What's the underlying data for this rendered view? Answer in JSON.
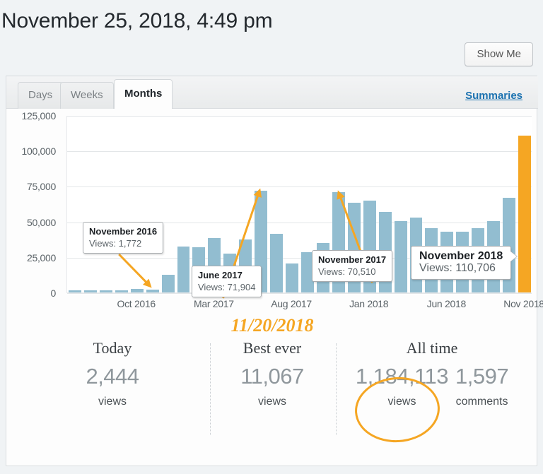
{
  "header": {
    "title": "November 25, 2018, 4:49 pm",
    "show_me_label": "Show Me"
  },
  "tabs": [
    {
      "label": "Days",
      "active": false
    },
    {
      "label": "Weeks",
      "active": false
    },
    {
      "label": "Months",
      "active": true
    }
  ],
  "summaries_link": "Summaries",
  "chart_data": {
    "type": "bar",
    "title": "",
    "xlabel": "",
    "ylabel": "",
    "ylim": [
      0,
      125000
    ],
    "grid": true,
    "legend": "none",
    "ytick_labels": [
      "125,000",
      "100,000",
      "75,000",
      "50,000",
      "25,000",
      "0"
    ],
    "ytick_values": [
      125000,
      100000,
      75000,
      50000,
      25000,
      0
    ],
    "xtick_labels": [
      "Oct 2016",
      "Mar 2017",
      "Aug 2017",
      "Jan 2018",
      "Jun 2018",
      "Nov 2018"
    ],
    "xtick_indices": [
      4,
      9,
      14,
      19,
      24,
      29
    ],
    "bar_color": "#92bdd0",
    "highlight_color": "#f5a623",
    "highlight_index": 29,
    "categories": [
      "Jun 2016",
      "Jul 2016",
      "Aug 2016",
      "Sep 2016",
      "Oct 2016",
      "Nov 2016",
      "Dec 2016",
      "Jan 2017",
      "Feb 2017",
      "Mar 2017",
      "Apr 2017",
      "May 2017",
      "Jun 2017",
      "Jul 2017",
      "Aug 2017",
      "Sep 2017",
      "Oct 2017",
      "Nov 2017",
      "Dec 2017",
      "Jan 2018",
      "Feb 2018",
      "Mar 2018",
      "Apr 2018",
      "May 2018",
      "Jun 2018",
      "Jul 2018",
      "Aug 2018",
      "Sep 2018",
      "Oct 2018",
      "Nov 2018"
    ],
    "values": [
      700,
      900,
      1100,
      1300,
      2300,
      1772,
      12500,
      32500,
      32000,
      38500,
      27500,
      37500,
      71904,
      41500,
      20500,
      28500,
      35000,
      70510,
      63500,
      64500,
      57000,
      50500,
      53000,
      45500,
      43000,
      43000,
      45500,
      50500,
      66500,
      110706
    ],
    "annotations": [
      {
        "label": "November 2016",
        "value_text": "Views: 1,772",
        "value": 1772,
        "index": 5
      },
      {
        "label": "June 2017",
        "value_text": "Views: 71,904",
        "value": 71904,
        "index": 12
      },
      {
        "label": "November 2017",
        "value_text": "Views: 70,510",
        "value": 70510,
        "index": 17
      },
      {
        "label": "November 2018",
        "value_text": "Views: 110,706",
        "value": 110706,
        "index": 29
      }
    ]
  },
  "stats": {
    "best_date": "11/20/2018",
    "columns": [
      {
        "label": "Today",
        "value": "2,444",
        "unit": "views"
      },
      {
        "label": "Best ever",
        "value": "11,067",
        "unit": "views"
      },
      {
        "label": "All time",
        "value": "1,184,113",
        "unit": "views",
        "secondary_value": "1,597",
        "secondary_unit": "comments"
      }
    ]
  }
}
